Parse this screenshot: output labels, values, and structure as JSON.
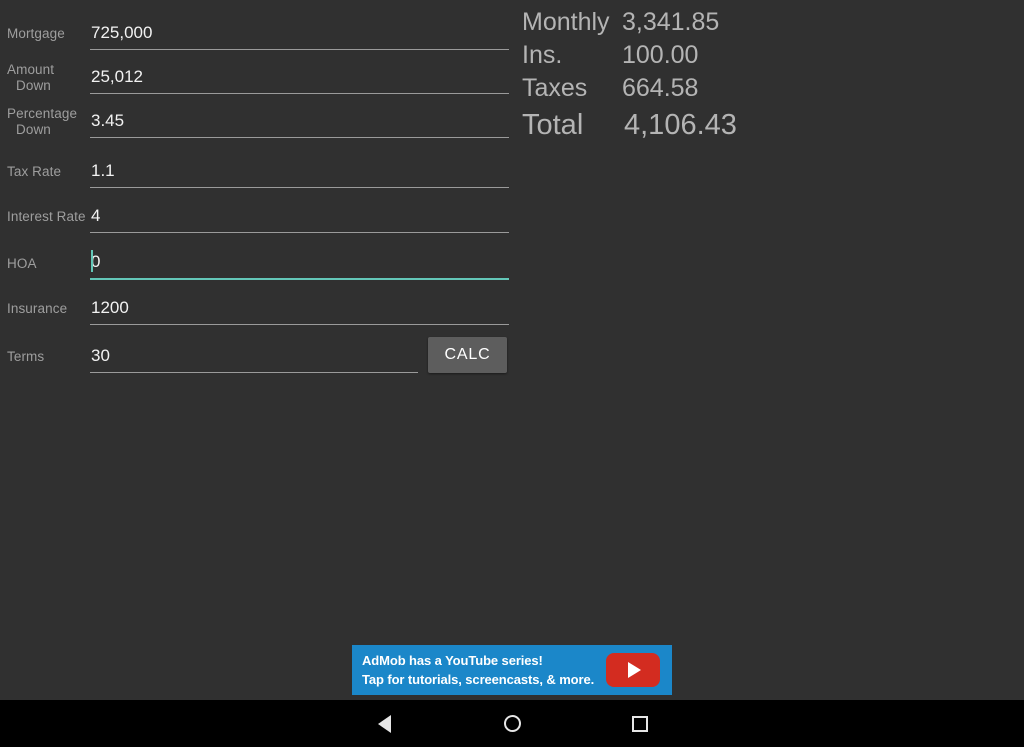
{
  "theme": {
    "background": "#303030",
    "input_text": "#f2f2f2",
    "label_text": "#9e9e9e",
    "underline": "#9a9a9a",
    "accent_focus": "#63c7b8",
    "result_text": "#b4b4b4",
    "button_bg": "#5d5d5d",
    "ad_bg": "#1b87c9",
    "ad_play_bg": "#d32c20",
    "navbar_bg": "#000000"
  },
  "form": {
    "fields": [
      {
        "label_line1": "Mortgage",
        "label_line2": "",
        "value": "725,000",
        "placeholder": "Mortgage",
        "focused": false,
        "short": false
      },
      {
        "label_line1": "Amount",
        "label_line2": "Down",
        "value": "25,012",
        "placeholder": "Amount Down",
        "focused": false,
        "short": false
      },
      {
        "label_line1": "Percentage",
        "label_line2": "Down",
        "value": "3.45",
        "placeholder": "Percent Down",
        "focused": false,
        "short": false
      },
      {
        "label_line1": "Tax Rate",
        "label_line2": "",
        "value": "1.1",
        "placeholder": "Tax Rate",
        "focused": false,
        "short": false
      },
      {
        "label_line1": "Interest Rate",
        "label_line2": "",
        "value": "4",
        "placeholder": "Interest Rate",
        "focused": false,
        "short": false
      },
      {
        "label_line1": "HOA",
        "label_line2": "",
        "value": "0",
        "placeholder": "HOA",
        "focused": true,
        "short": false
      },
      {
        "label_line1": "Insurance",
        "label_line2": "",
        "value": "1200",
        "placeholder": "Insurance",
        "focused": false,
        "short": false
      },
      {
        "label_line1": "Terms",
        "label_line2": "",
        "value": "30",
        "placeholder": "Terms",
        "focused": false,
        "short": true
      }
    ],
    "calc_label": "CALC"
  },
  "results": {
    "rows": [
      {
        "label": "Monthly",
        "value": "3,341.85"
      },
      {
        "label": "Ins.",
        "value": "100.00"
      },
      {
        "label": "Taxes",
        "value": "664.58"
      },
      {
        "label": "Total",
        "value": "4,106.43"
      }
    ]
  },
  "ad": {
    "line1": "AdMob has a YouTube series!",
    "line2": "Tap for tutorials, screencasts, & more.",
    "play_icon": "play-triangle-icon"
  },
  "navbar": {
    "back": "back-icon",
    "home": "home-icon",
    "recents": "recents-icon"
  }
}
